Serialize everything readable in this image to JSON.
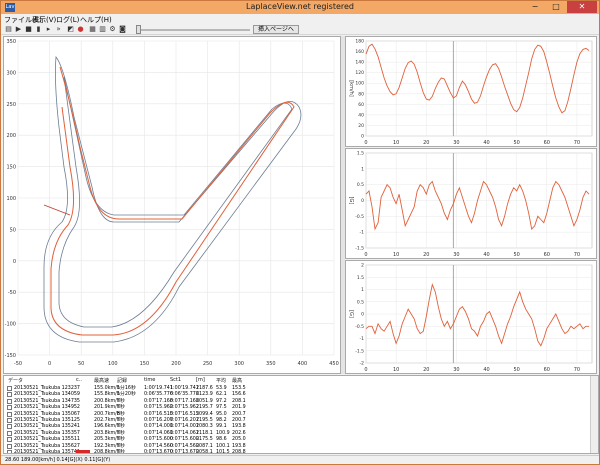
{
  "window": {
    "title": "LaplaceView.net registered",
    "icon_label": "Lav",
    "min_glyph": "−",
    "max_glyph": "□",
    "close_glyph": "✕"
  },
  "menu": [
    "ファイル(E)",
    "表示(V)",
    "ログ(L)",
    "ヘルプ(H)"
  ],
  "toolbar": {
    "icons": [
      "open-file-icon",
      "play-icon",
      "stop-icon",
      "pause-icon",
      "step-icon",
      "speed-icon",
      "map-icon",
      "record-icon",
      "table-icon",
      "bookmark-icon",
      "settings-icon",
      "camera-icon"
    ],
    "slider_value": 0,
    "insert_page_label": "挿入ページへ"
  },
  "map": {
    "x_ticks": [
      "-50",
      "0",
      "50",
      "100",
      "150",
      "200",
      "250",
      "300",
      "350",
      "400",
      "450"
    ],
    "y_ticks": [
      "350",
      "300",
      "250",
      "200",
      "150",
      "100",
      "50",
      "0",
      "-50",
      "-100",
      "-150"
    ]
  },
  "colors": {
    "trace": "#e0603a",
    "track": "#6b7d93",
    "grid": "#e6e6e6",
    "accent": "#f3a866"
  },
  "chart_data": [
    {
      "type": "line",
      "title": "",
      "xlabel": "",
      "ylabel": "[km/h]",
      "xlim": [
        0,
        75
      ],
      "ylim": [
        0,
        180
      ],
      "x_ticks": [
        "0",
        "10",
        "20",
        "30",
        "40",
        "50",
        "60",
        "70"
      ],
      "y_ticks": [
        "0",
        "20",
        "40",
        "60",
        "80",
        "100",
        "120",
        "140",
        "160",
        "180"
      ],
      "cursor_x": 29,
      "x": [
        0,
        1,
        2,
        3,
        4,
        5,
        6,
        7,
        8,
        9,
        10,
        11,
        12,
        13,
        14,
        15,
        16,
        17,
        18,
        19,
        20,
        21,
        22,
        23,
        24,
        25,
        26,
        27,
        28,
        29,
        30,
        31,
        32,
        33,
        34,
        35,
        36,
        37,
        38,
        39,
        40,
        41,
        42,
        43,
        44,
        45,
        46,
        47,
        48,
        49,
        50,
        51,
        52,
        53,
        54,
        55,
        56,
        57,
        58,
        59,
        60,
        61,
        62,
        63,
        64,
        65,
        66,
        67,
        68,
        69,
        70,
        71,
        72,
        73,
        74
      ],
      "values": [
        155,
        170,
        174,
        165,
        150,
        130,
        110,
        95,
        84,
        78,
        80,
        92,
        110,
        128,
        139,
        142,
        136,
        121,
        101,
        82,
        70,
        68,
        75,
        90,
        102,
        110,
        108,
        95,
        82,
        72,
        76,
        92,
        104,
        97,
        84,
        70,
        62,
        64,
        76,
        95,
        112,
        126,
        135,
        137,
        128,
        112,
        94,
        78,
        62,
        50,
        46,
        54,
        72,
        96,
        120,
        146,
        164,
        172,
        170,
        160,
        140,
        118,
        94,
        72,
        55,
        44,
        48,
        66,
        90,
        116,
        140,
        156,
        164,
        166,
        162
      ]
    },
    {
      "type": "line",
      "title": "",
      "xlabel": "",
      "ylabel": "[G]",
      "xlim": [
        0,
        75
      ],
      "ylim": [
        -1.5,
        1.5
      ],
      "x_ticks": [
        "0",
        "10",
        "20",
        "30",
        "40",
        "50",
        "60",
        "70"
      ],
      "y_ticks": [
        "1.5",
        "1",
        "0.5",
        "0",
        "-0.5",
        "-1",
        "-1.5"
      ],
      "cursor_x": 29,
      "x": [
        0,
        1,
        2,
        3,
        4,
        5,
        6,
        7,
        8,
        9,
        10,
        11,
        12,
        13,
        14,
        15,
        16,
        17,
        18,
        19,
        20,
        21,
        22,
        23,
        24,
        25,
        26,
        27,
        28,
        29,
        30,
        31,
        32,
        33,
        34,
        35,
        36,
        37,
        38,
        39,
        40,
        41,
        42,
        43,
        44,
        45,
        46,
        47,
        48,
        49,
        50,
        51,
        52,
        53,
        54,
        55,
        56,
        57,
        58,
        59,
        60,
        61,
        62,
        63,
        64,
        65,
        66,
        67,
        68,
        69,
        70,
        71,
        72,
        73,
        74
      ],
      "values": [
        0.2,
        0.3,
        -0.2,
        -0.9,
        -0.7,
        0.1,
        0.3,
        0.5,
        0.4,
        0.1,
        -0.1,
        0.2,
        -0.3,
        -0.8,
        -0.6,
        -0.4,
        -0.2,
        0.3,
        0.5,
        0.4,
        0.2,
        0.5,
        0.6,
        0.3,
        0.1,
        -0.1,
        -0.4,
        -0.6,
        -0.3,
        -0.1,
        0.2,
        0.4,
        0.1,
        -0.2,
        -0.5,
        -0.7,
        -0.4,
        0.0,
        0.3,
        0.6,
        0.5,
        0.3,
        0.1,
        -0.2,
        -0.6,
        -0.8,
        -0.5,
        -0.1,
        0.2,
        0.4,
        0.3,
        0.5,
        0.3,
        0.0,
        -0.4,
        -0.9,
        -0.8,
        -0.5,
        -0.6,
        -0.7,
        -0.4,
        0.0,
        0.4,
        0.6,
        0.5,
        0.3,
        0.1,
        -0.2,
        -0.5,
        -0.8,
        -0.6,
        -0.3,
        0.1,
        0.3,
        0.2
      ]
    },
    {
      "type": "line",
      "title": "",
      "xlabel": "",
      "ylabel": "[G]",
      "xlim": [
        0,
        75
      ],
      "ylim": [
        -2,
        2
      ],
      "x_ticks": [
        "0",
        "10",
        "20",
        "30",
        "40",
        "50",
        "60",
        "70"
      ],
      "y_ticks": [
        "2",
        "1.5",
        "1",
        "0.5",
        "0",
        "-0.5",
        "-1",
        "-1.5",
        "-2"
      ],
      "cursor_x": 29,
      "x": [
        0,
        1,
        2,
        3,
        4,
        5,
        6,
        7,
        8,
        9,
        10,
        11,
        12,
        13,
        14,
        15,
        16,
        17,
        18,
        19,
        20,
        21,
        22,
        23,
        24,
        25,
        26,
        27,
        28,
        29,
        30,
        31,
        32,
        33,
        34,
        35,
        36,
        37,
        38,
        39,
        40,
        41,
        42,
        43,
        44,
        45,
        46,
        47,
        48,
        49,
        50,
        51,
        52,
        53,
        54,
        55,
        56,
        57,
        58,
        59,
        60,
        61,
        62,
        63,
        64,
        65,
        66,
        67,
        68,
        69,
        70,
        71,
        72,
        73,
        74
      ],
      "values": [
        -0.6,
        -0.5,
        -0.5,
        -0.8,
        -0.4,
        -0.6,
        -0.7,
        -0.5,
        -0.3,
        -0.8,
        -1.2,
        -0.9,
        -0.4,
        -0.1,
        0.2,
        0.0,
        -0.2,
        -0.6,
        -0.8,
        -0.7,
        -0.1,
        0.6,
        1.2,
        0.9,
        0.3,
        -0.2,
        -0.5,
        -0.3,
        -0.6,
        -0.4,
        -0.1,
        0.2,
        0.3,
        0.1,
        -0.2,
        -0.6,
        -0.7,
        -0.9,
        -0.5,
        -0.3,
        0.0,
        0.1,
        -0.2,
        -0.5,
        -0.9,
        -1.2,
        -0.8,
        -0.4,
        -0.1,
        0.3,
        0.6,
        0.9,
        0.5,
        0.2,
        0.0,
        -0.2,
        -0.6,
        -1.1,
        -1.3,
        -1.0,
        -0.6,
        -0.4,
        -0.2,
        0.0,
        -0.3,
        -0.6,
        -0.8,
        -0.7,
        -0.5,
        -0.6,
        -0.5,
        -0.4,
        -0.6,
        -0.5,
        -0.5
      ]
    }
  ],
  "table": {
    "columns": [
      "データ",
      "c..",
      "最高速",
      "記録",
      "time",
      "Sct1",
      "[m]",
      "平均",
      "最高"
    ],
    "rows": [
      [
        "20130521_Tsukuba 123237",
        "",
        "155.0km/h",
        "1分16秒",
        "1:00'19.741",
        "1:00'19.741",
        "2187.6",
        "53.9",
        "153.5"
      ],
      [
        "20130521_Tsukuba 134059",
        "",
        "155.8km/h",
        "1分20秒",
        "0:06'35.776",
        "0:06'35.776",
        "2123.9",
        "62.1",
        "156.6"
      ],
      [
        "20130521_Tsukuba 134735",
        "",
        "200.8km/h",
        "7秒",
        "0:07'17.168",
        "0:07'17.168",
        "2051.9",
        "97.2",
        "208.1"
      ],
      [
        "20130521_Tsukuba 134952",
        "",
        "201.9km/h",
        "7秒",
        "0:07'15.962",
        "0:07'15.962",
        "2195.7",
        "97.5",
        "201.9"
      ],
      [
        "20130521_Tsukuba 135067",
        "",
        "200.7km/h",
        "8秒",
        "0:07'16.515",
        "0:07'16.515",
        "2099.4",
        "95.0",
        "200.7"
      ],
      [
        "20130521_Tsukuba 135125",
        "",
        "202.7km/h",
        "7秒",
        "0:07'16.207",
        "0:07'16.207",
        "2195.5",
        "98.2",
        "200.7"
      ],
      [
        "20130521_Tsukuba 135241",
        "",
        "196.6km/h",
        "7秒",
        "0:07'14.001",
        "0:07'14.001",
        "2080.3",
        "99.1",
        "193.8"
      ],
      [
        "20130521_Tsukuba 135357",
        "",
        "203.8km/h",
        "7秒",
        "0:07'14.061",
        "0:07'14.061",
        "2118.1",
        "100.9",
        "202.6"
      ],
      [
        "20130521_Tsukuba 135511",
        "",
        "205.3km/h",
        "7秒",
        "0:07'15.600",
        "0:07'15.600",
        "2175.5",
        "98.6",
        "205.0"
      ],
      [
        "20130521_Tsukuba 135627",
        "",
        "192.3km/h",
        "7秒",
        "0:07'14.560",
        "0:07'14.560",
        "2087.1",
        "100.1",
        "193.8"
      ],
      [
        "20130521_Tsukuba 135741",
        "red",
        "208.8km/h",
        "7秒",
        "0:07'13.670",
        "0:07'13.670",
        "2058.1",
        "101.5",
        "208.8"
      ]
    ]
  },
  "status": {
    "text": "28.60  189.00[km/h]  0.14[G](X)  0.11[G](Y)"
  }
}
